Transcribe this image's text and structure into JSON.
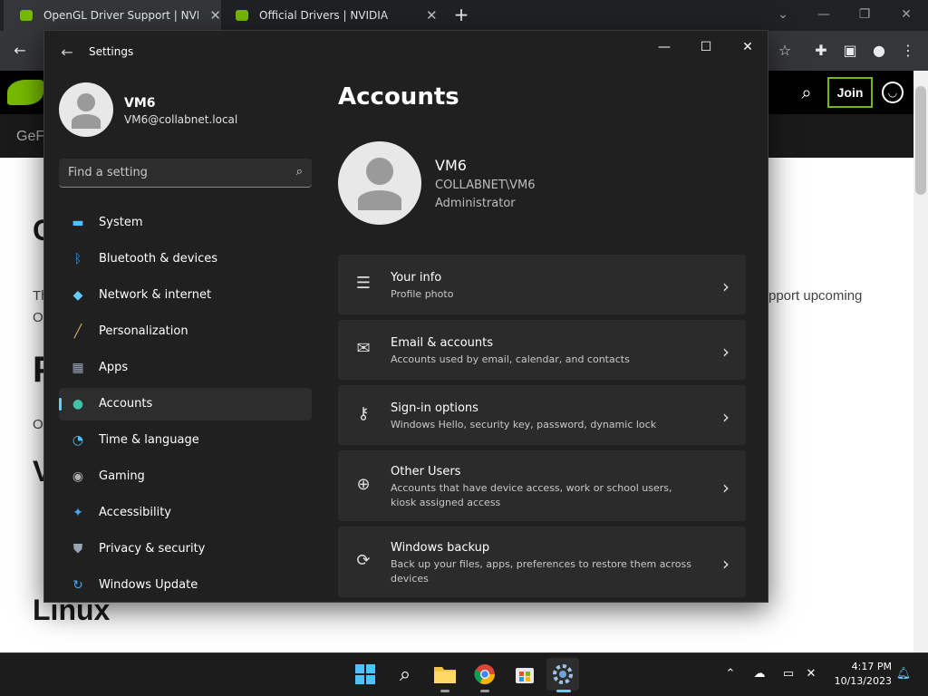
{
  "browser": {
    "tabs": [
      {
        "title": "OpenGL Driver Support | NVIDIA",
        "close": "✕"
      },
      {
        "title": "Official Drivers | NVIDIA",
        "close": "✕"
      }
    ],
    "new_tab": "+"
  },
  "nvidia_page": {
    "join_label": "Join",
    "subnav_fragment": "GeF",
    "left_fragments": [
      "C",
      "Th",
      "O",
      "P",
      "O",
      "V"
    ],
    "right_fragment": "pport upcoming",
    "linux_heading": "Linux"
  },
  "settings": {
    "window_title": "Settings",
    "user": {
      "name": "VM6",
      "email": "VM6@collabnet.local"
    },
    "search": {
      "placeholder": "Find a setting"
    },
    "nav": [
      {
        "label": "System",
        "icon": "monitor-icon",
        "color": "#4cc2ff"
      },
      {
        "label": "Bluetooth & devices",
        "icon": "bluetooth-icon",
        "color": "#3a96dd"
      },
      {
        "label": "Network & internet",
        "icon": "wifi-icon",
        "color": "#60cdff"
      },
      {
        "label": "Personalization",
        "icon": "brush-icon",
        "color": "#e0a96d"
      },
      {
        "label": "Apps",
        "icon": "apps-icon",
        "color": "#9aa5b5"
      },
      {
        "label": "Accounts",
        "icon": "person-icon",
        "color": "#3fc1a5"
      },
      {
        "label": "Time & language",
        "icon": "globe-clock-icon",
        "color": "#4cc2ff"
      },
      {
        "label": "Gaming",
        "icon": "gamepad-icon",
        "color": "#b0b0b0"
      },
      {
        "label": "Accessibility",
        "icon": "accessibility-icon",
        "color": "#3fa9f5"
      },
      {
        "label": "Privacy & security",
        "icon": "shield-icon",
        "color": "#9aa5b5"
      },
      {
        "label": "Windows Update",
        "icon": "update-icon",
        "color": "#3fa9f5"
      }
    ],
    "selected_nav": "Accounts",
    "page_title": "Accounts",
    "account": {
      "name": "VM6",
      "domain": "COLLABNET\\VM6",
      "role": "Administrator"
    },
    "cards": [
      {
        "title": "Your info",
        "subtitle": "Profile photo",
        "icon": "id-card-icon"
      },
      {
        "title": "Email & accounts",
        "subtitle": "Accounts used by email, calendar, and contacts",
        "icon": "mail-icon"
      },
      {
        "title": "Sign-in options",
        "subtitle": "Windows Hello, security key, password, dynamic lock",
        "icon": "key-icon"
      },
      {
        "title": "Other Users",
        "subtitle": "Accounts that have device access, work or school users, kiosk assigned access",
        "icon": "add-user-icon"
      },
      {
        "title": "Windows backup",
        "subtitle": "Back up your files, apps, preferences to restore them across devices",
        "icon": "backup-icon"
      }
    ]
  },
  "taskbar": {
    "time": "4:17 PM",
    "date": "10/13/2023"
  }
}
